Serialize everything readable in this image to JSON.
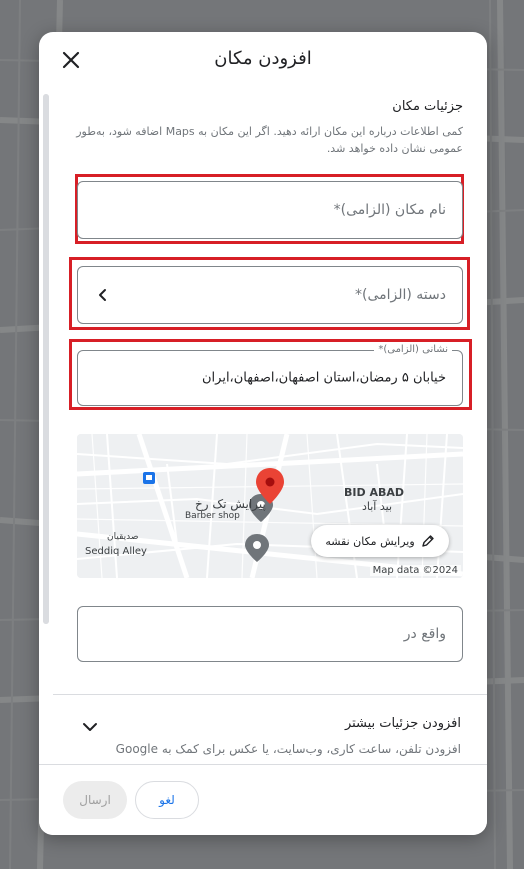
{
  "dialog": {
    "title": "افزودن مکان"
  },
  "details": {
    "title": "جزئیات مکان",
    "description": "کمی اطلاعات درباره این مکان ارائه دهید. اگر این مکان به Maps اضافه شود، به‌طور عمومی نشان داده خواهد شد."
  },
  "fields": {
    "name_placeholder": "نام مکان (الزامی)*",
    "category_placeholder": "دسته (الزامی)*",
    "address_label": "نشانی (الزامی)*",
    "address_value": "خیابان ۵ رمضان،استان اصفهان،اصفهان،ایران",
    "located_in_placeholder": "واقع در"
  },
  "map": {
    "label_bid_abad_en": "BID ABAD",
    "label_bid_abad_fa": "بید آباد",
    "label_barber_fa": "پیرایش تک رخ",
    "label_barber_en": "Barber shop",
    "label_seddiq_fa": "صدیقیان",
    "label_seddiq_en": "Seddiq Alley",
    "edit_button": "ویرایش مکان نقشه",
    "attribution": "Map data ©2024"
  },
  "more_details": {
    "title": "افزودن جزئیات بیشتر",
    "description": "افزودن تلفن، ساعت کاری، وب‌سایت، یا عکس برای کمک به Google"
  },
  "footer": {
    "cancel_label": "لغو",
    "send_label": "ارسال"
  },
  "colors": {
    "highlight": "#d71f26",
    "accent": "#1a73e8",
    "pin": "#ea4335"
  }
}
